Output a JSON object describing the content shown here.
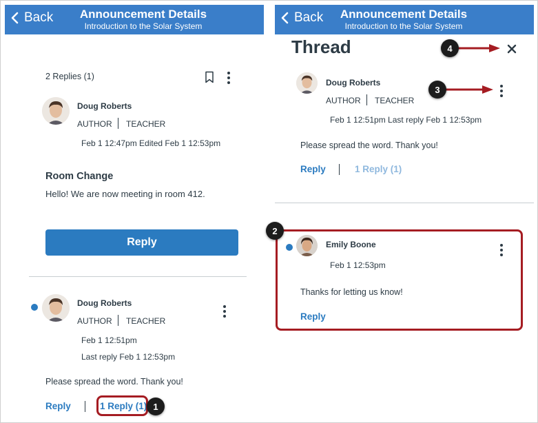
{
  "left": {
    "header": {
      "back": "Back",
      "title": "Announcement Details",
      "subtitle": "Introduction to the Solar System"
    },
    "summary": "2 Replies (1)",
    "post": {
      "author": "Doug Roberts",
      "role_author": "AUTHOR",
      "role_teacher": "TEACHER",
      "date": "Feb 1 12:47pm   Edited Feb 1 12:53pm",
      "title": "Room Change",
      "body": "Hello! We are now meeting in room 412.",
      "reply_button": "Reply"
    },
    "entry": {
      "author": "Doug Roberts",
      "role_author": "AUTHOR",
      "role_teacher": "TEACHER",
      "date": "Feb 1 12:51pm",
      "last_reply": "Last reply Feb 1 12:53pm",
      "body": "Please spread the word. Thank you!",
      "reply": "Reply",
      "replies_link": "1 Reply (1)"
    }
  },
  "right": {
    "header": {
      "back": "Back",
      "title": "Announcement Details",
      "subtitle": "Introduction to the Solar System"
    },
    "thread_title": "Thread",
    "entry": {
      "author": "Doug Roberts",
      "role_author": "AUTHOR",
      "role_teacher": "TEACHER",
      "date": "Feb 1 12:51pm   Last reply Feb 1 12:53pm",
      "body": "Please spread the word. Thank you!",
      "reply": "Reply",
      "replies_link": "1 Reply (1)"
    },
    "reply_entry": {
      "author": "Emily Boone",
      "date": "Feb 1 12:53pm",
      "body": "Thanks for letting us know!",
      "reply": "Reply"
    }
  },
  "callouts": {
    "c1": "1",
    "c2": "2",
    "c3": "3",
    "c4": "4"
  },
  "colors": {
    "header": "#3a7ec9",
    "button": "#2b7bc0",
    "link": "#2b7bc0",
    "annotation": "#a51c22",
    "unread": "#2b7bc0"
  },
  "icons": [
    "chevron-left-icon",
    "bookmark-icon",
    "more-vertical-icon",
    "close-icon",
    "arrow-right-icon"
  ]
}
